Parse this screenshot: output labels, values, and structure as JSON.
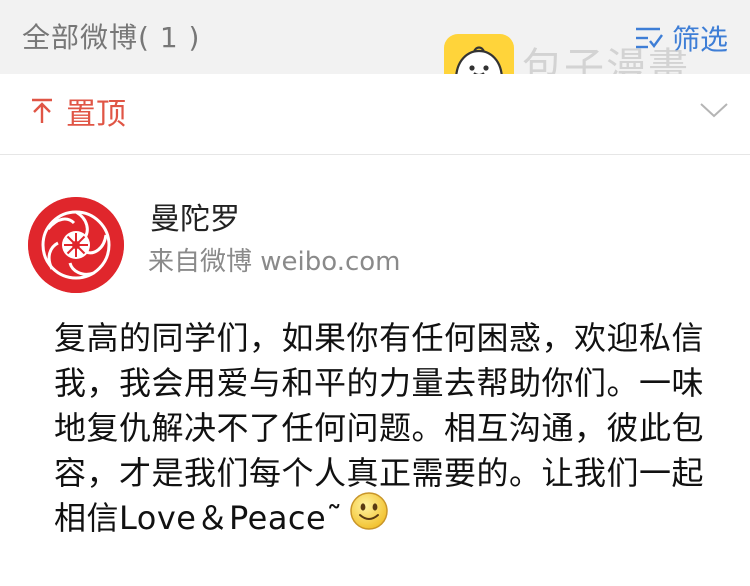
{
  "filter_bar": {
    "count_label": "全部微博( 1 )",
    "filter_label": "筛选"
  },
  "watermark": {
    "text": "包子漫畫"
  },
  "pinned": {
    "label": "置顶"
  },
  "post": {
    "author": "曼陀罗",
    "source": "来自微博 weibo.com",
    "body": "复高的同学们，如果你有任何困惑，欢迎私信我，我会用爱与和平的力量去帮助你们。一味地复仇解决不了任何问题。相互沟通，彼此包容，才是我们每个人真正需要的。让我们一起相信Love＆Peace˜",
    "emoji": "smile-icon"
  },
  "colors": {
    "accent_blue": "#3e7ed6",
    "pinned_red": "#e05545",
    "avatar_red": "#e0262c",
    "watermark_yellow": "#ffd43a"
  }
}
